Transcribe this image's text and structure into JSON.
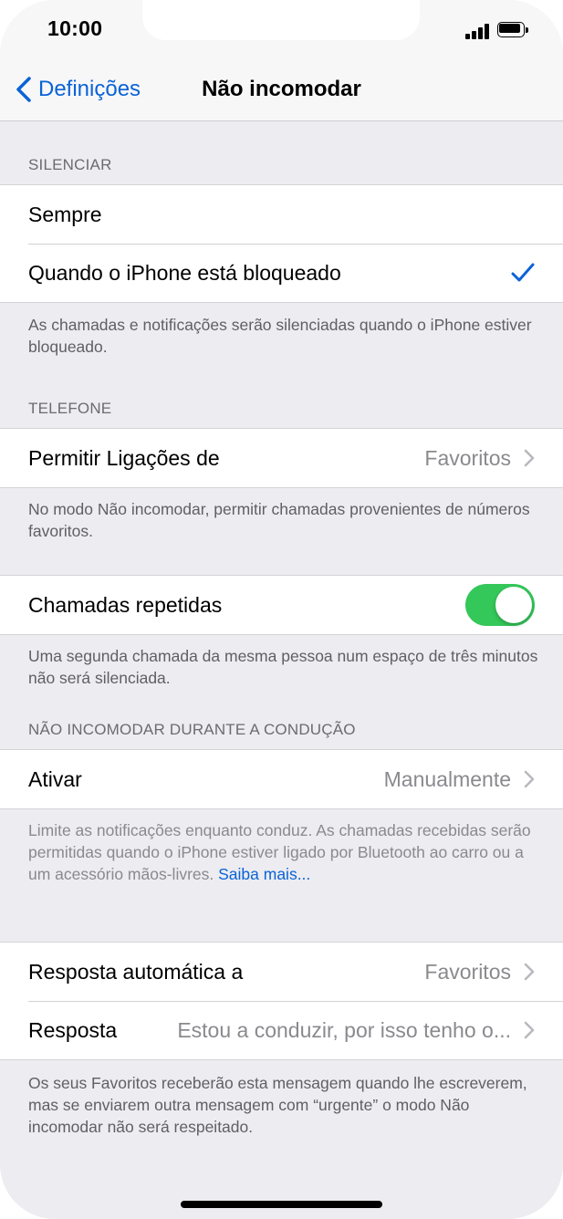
{
  "status_bar": {
    "time": "10:00"
  },
  "nav": {
    "back_label": "Definições",
    "title": "Não incomodar"
  },
  "silence_section": {
    "header": "SILENCIAR",
    "options": [
      {
        "label": "Sempre",
        "selected": false
      },
      {
        "label": "Quando o iPhone está bloqueado",
        "selected": true
      }
    ],
    "footer": "As chamadas e notificações serão silenciadas quando o iPhone estiver bloqueado."
  },
  "phone_section": {
    "header": "TELEFONE",
    "allow_calls_label": "Permitir Ligações de",
    "allow_calls_value": "Favoritos",
    "footer": "No modo Não incomodar, permitir chamadas provenientes de números favoritos."
  },
  "repeated_calls": {
    "label": "Chamadas repetidas",
    "enabled": true,
    "footer": "Uma segunda chamada da mesma pessoa num espaço de três minutos não será silenciada."
  },
  "driving_section": {
    "header": "NÃO INCOMODAR DURANTE A CONDUÇÃO",
    "activate_label": "Ativar",
    "activate_value": "Manualmente",
    "footer": "Limite as notificações enquanto conduz. As chamadas recebidas serão permitidas quando o iPhone estiver ligado por Bluetooth ao carro ou a um acessório mãos-livres.",
    "footer_link": "Saiba mais..."
  },
  "auto_reply_section": {
    "auto_reply_to_label": "Resposta automática a",
    "auto_reply_to_value": "Favoritos",
    "reply_label": "Resposta",
    "reply_value": "Estou a conduzir, por isso tenho o...",
    "footer": "Os seus Favoritos receberão esta mensagem quando lhe escreverem, mas se enviarem outra mensagem com “urgente” o modo Não incomodar não será respeitado."
  },
  "colors": {
    "accent": "#0a63d6",
    "toggle_on": "#34c759",
    "grouped_background": "#ececf1"
  }
}
